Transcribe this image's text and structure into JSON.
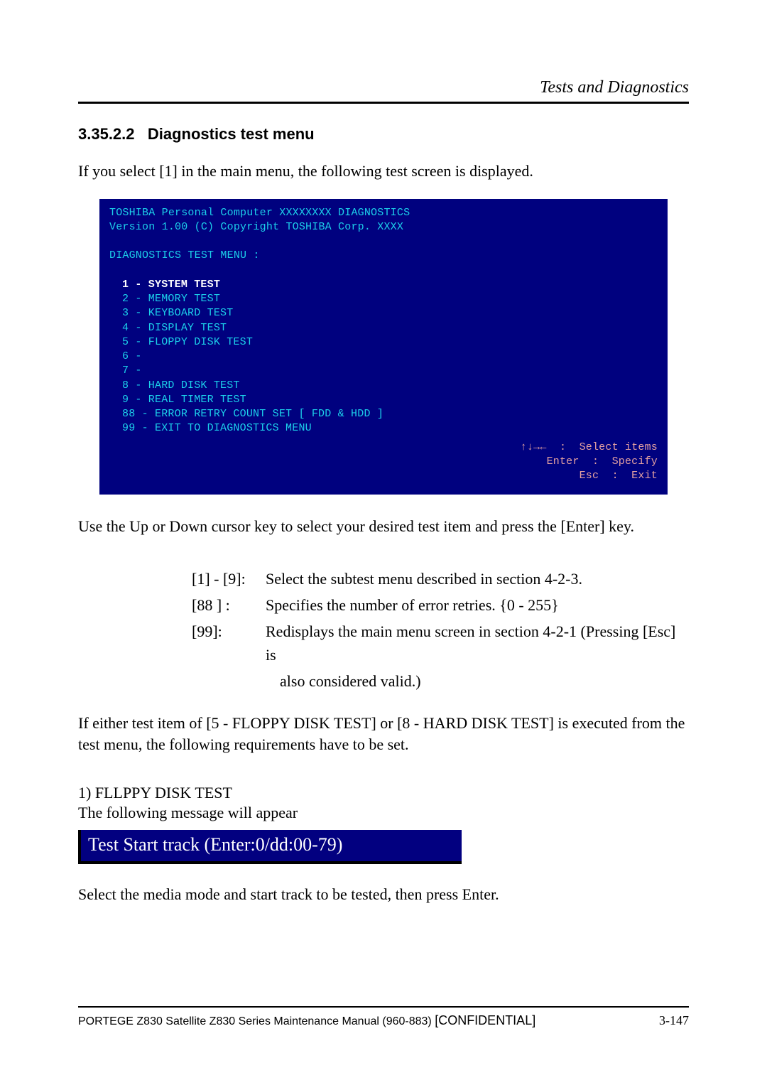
{
  "chapter": "Tests and Diagnostics",
  "section_number": "3.35.2.2",
  "section_title": "Diagnostics test menu",
  "intro_para": "If you select [1] in the main menu, the following test screen is displayed.",
  "diag": {
    "line1": "TOSHIBA Personal Computer XXXXXXXX DIAGNOSTICS",
    "line2": "Version 1.00  (C) Copyright TOSHIBA Corp. XXXX",
    "menu_title": "DIAGNOSTICS TEST MENU  :",
    "items": [
      " 1 - SYSTEM TEST",
      " 2 - MEMORY TEST",
      " 3 - KEYBOARD TEST",
      " 4 - DISPLAY TEST",
      " 5 - FLOPPY DISK TEST",
      " 6 -",
      " 7 -",
      " 8 - HARD DISK TEST",
      " 9 - REAL TIMER TEST",
      "88 - ERROR RETRY COUNT SET [ FDD & HDD ]",
      "99 - EXIT TO DIAGNOSTICS MENU"
    ],
    "keys_l1": "↑↓→←  :  Select items",
    "keys_l2": "Enter  :  Specify",
    "keys_l3": "  Esc  :  Exit"
  },
  "after_screenshot": "Use the Up or Down cursor key to select your desired test item and press the [Enter] key.",
  "info": {
    "r1_key": "[1] - [9]:",
    "r1_val": "Select the subtest menu described in section 4-2-3.",
    "r2_key": "[88 ] :",
    "r2_val": "Specifies the number of error retries.  {0 - 255}",
    "r3_key": "[99]:",
    "r3_val": "Redisplays the main menu screen in section 4-2-1 (Pressing [Esc] is",
    "r3_val2": "also considered valid.)"
  },
  "condition_para": "If either test item of [5 - FLOPPY DISK TEST] or [8 - HARD DISK TEST] is executed from the test menu, the following requirements have to be set.",
  "fd_head": "1) FLLPPY DISK TEST",
  "fd_sub": "The following message will appear",
  "track_bar": "Test Start track (Enter:0/dd:00-79)",
  "select_media": "Select the media mode and start track to be tested, then press Enter.",
  "footer_left_a": "PORTEGE Z830 Satellite Z830 Series Maintenance Manual (960-883) ",
  "footer_left_b": "[CONFIDENTIAL]",
  "footer_right": "3-147"
}
